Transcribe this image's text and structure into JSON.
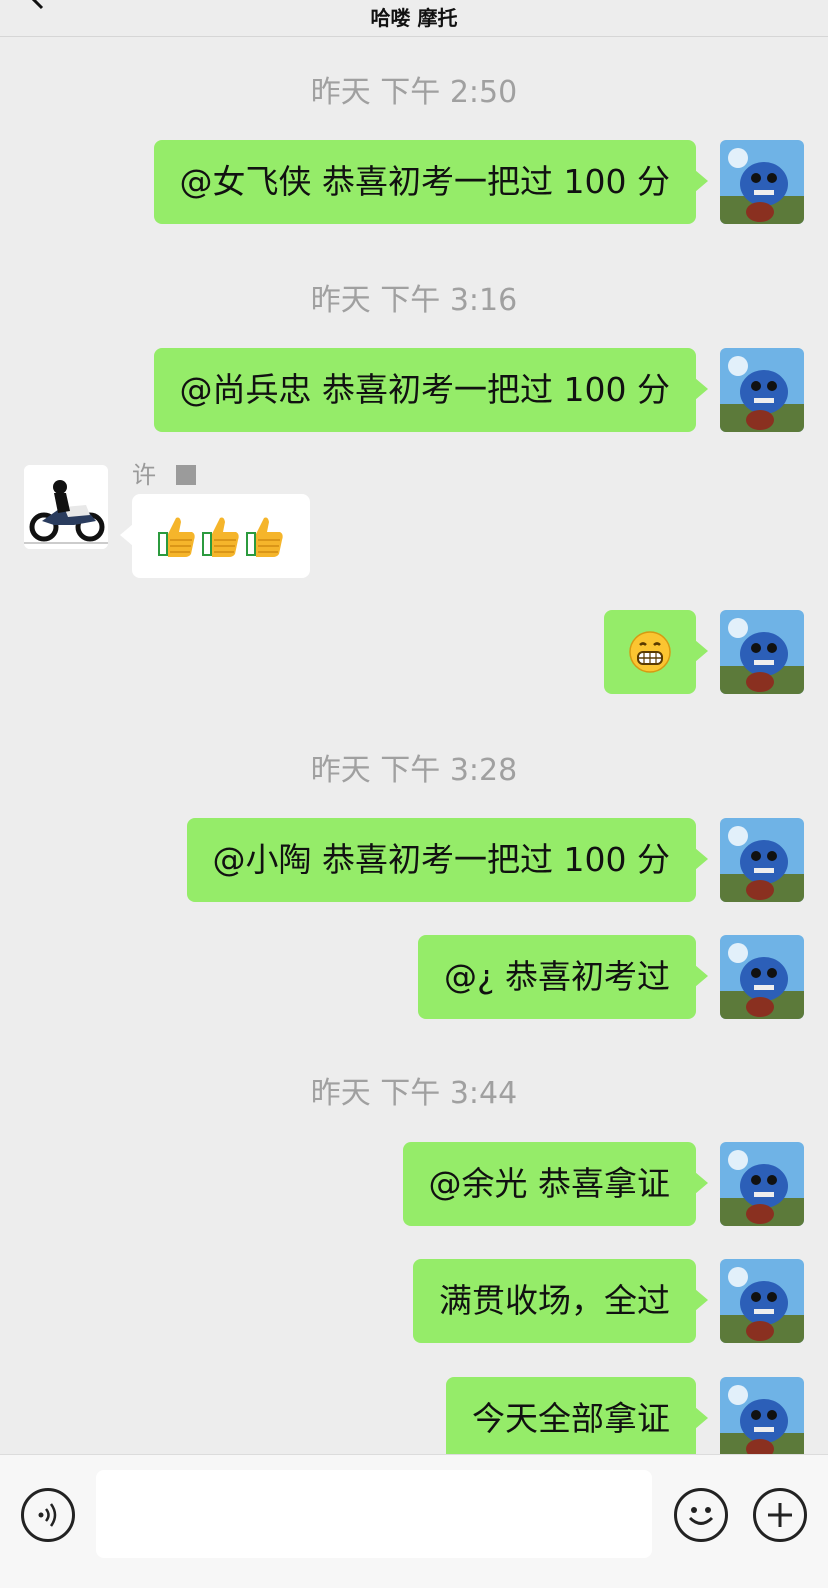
{
  "header": {
    "title": "哈喽 摩托"
  },
  "chat": {
    "timestamps": [
      "昨天 下午 2:50",
      "昨天 下午 3:16",
      "昨天 下午 3:28",
      "昨天 下午 3:44"
    ],
    "sender_name": "许",
    "messages": [
      {
        "from": "self",
        "text": "@女飞侠 恭喜初考一把过 100 分"
      },
      {
        "from": "self",
        "text": "@尚兵忠 恭喜初考一把过 100 分"
      },
      {
        "from": "other",
        "text": "",
        "emoji": [
          "thumbs-up",
          "thumbs-up",
          "thumbs-up"
        ]
      },
      {
        "from": "self",
        "text": "",
        "emoji": [
          "grinning-face"
        ]
      },
      {
        "from": "self",
        "text": "@小陶 恭喜初考一把过 100 分"
      },
      {
        "from": "self",
        "text": "@¿ 恭喜初考过"
      },
      {
        "from": "self",
        "text": "@余光 恭喜拿证"
      },
      {
        "from": "self",
        "text": "满贯收场，全过"
      },
      {
        "from": "self",
        "text": "今天全部拿证"
      }
    ]
  },
  "input_bar": {
    "value": "",
    "icons": [
      "voice-icon",
      "emoji-icon",
      "plus-icon"
    ]
  }
}
